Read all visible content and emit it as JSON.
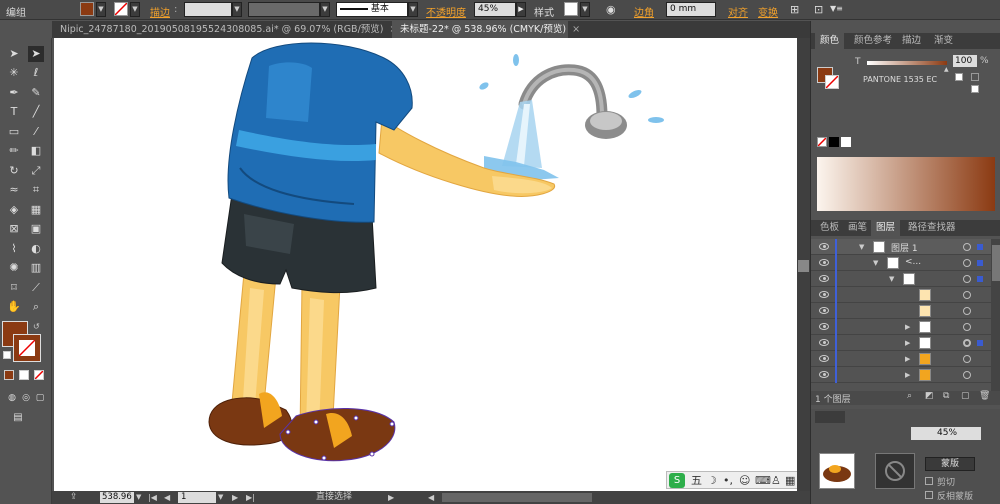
{
  "control_bar": {
    "mode_label": "编组",
    "stroke_label": "描边",
    "stroke_profile": "基本",
    "opacity_label": "不透明度",
    "opacity_value": "45%",
    "style_label": "样式",
    "corner_label": "边角",
    "corner_value": "0 mm",
    "align_label": "对齐",
    "transform_label": "变换",
    "fill_color": "#8b3a12"
  },
  "document_tabs": [
    {
      "label": "Nipic_24787180_20190508195524308085.ai* @ 69.07% (RGB/预览)",
      "close": "×"
    },
    {
      "label": "未标题-22* @ 538.96% (CMYK/预览)",
      "close": "×"
    }
  ],
  "toolbar": {
    "tools": [
      "selection-tool",
      "direct-selection-tool",
      "magic-wand-tool",
      "lasso-tool",
      "pen-tool",
      "curvature-tool",
      "type-tool",
      "line-tool",
      "rectangle-tool",
      "paintbrush-tool",
      "pencil-tool",
      "eraser-tool",
      "rotate-tool",
      "scale-tool",
      "warp-tool",
      "free-transform-tool",
      "shape-builder-tool",
      "perspective-grid-tool",
      "mesh-tool",
      "gradient-tool",
      "eyedropper-tool",
      "blend-tool",
      "symbol-sprayer-tool",
      "column-graph-tool",
      "artboard-tool",
      "slice-tool",
      "hand-tool",
      "zoom-tool"
    ],
    "fill_color": "#8b3a12",
    "stroke_color": "#8b3a12"
  },
  "status_bar": {
    "zoom": "538.96",
    "page": "1",
    "tool_name": "直接选择"
  },
  "color_panel": {
    "tabs": [
      "颜色",
      "颜色参考",
      "描边",
      "渐变"
    ],
    "t_label": "T",
    "tint_value": "100",
    "percent": "%",
    "swatch_name": "PANTONE 1535 EC",
    "ramp_start": "#ffffff",
    "ramp_end": "#8b3a12"
  },
  "layers_panel": {
    "tabs": [
      "色板",
      "画笔",
      "图层",
      "路径查找器"
    ],
    "layer_name": "图层 1",
    "group_name": "<...",
    "count_label": "1 个图层"
  },
  "bottom_panel": {
    "opacity_value": "45%",
    "clip_label": "剪切",
    "invert_mask_label": "反相蒙版",
    "mask_button": "蒙版"
  },
  "ime_bar": {
    "label": "五"
  }
}
